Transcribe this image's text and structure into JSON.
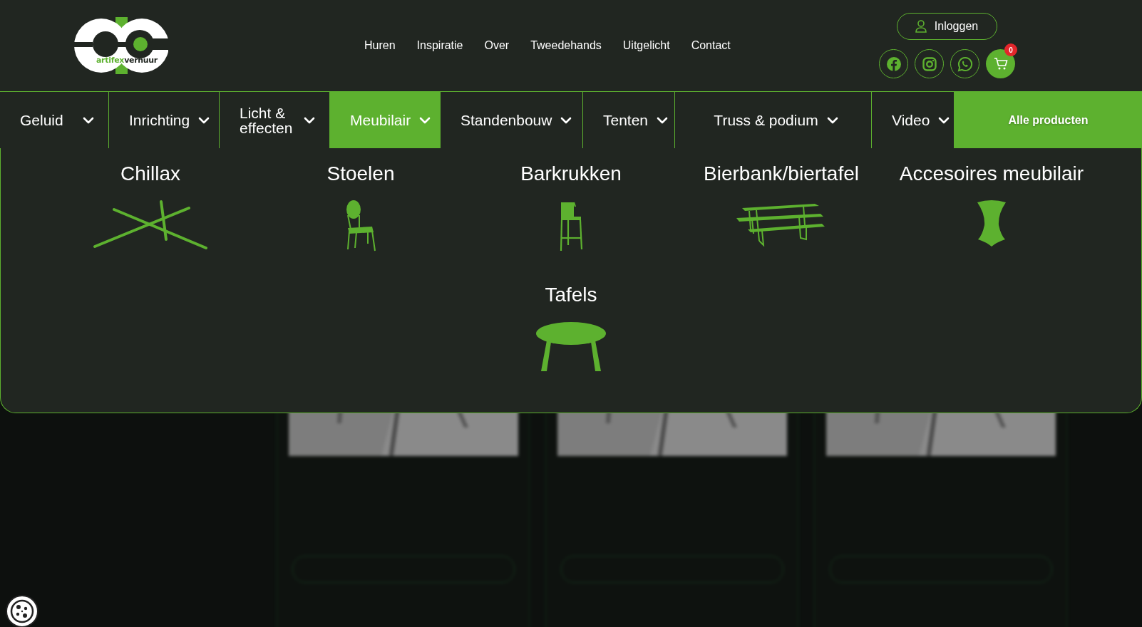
{
  "logo": {
    "text_green": "artifex",
    "text_dark": "verhuur"
  },
  "main_nav": [
    "Huren",
    "Inspiratie",
    "Over",
    "Tweedehands",
    "Uitgelicht",
    "Contact"
  ],
  "login_button": {
    "label": "Inloggen"
  },
  "social_links": [
    {
      "kind": "facebook"
    },
    {
      "kind": "instagram"
    },
    {
      "kind": "whatsapp"
    }
  ],
  "cart": {
    "count": "0"
  },
  "categories": [
    {
      "label": "Geluid",
      "selected": false
    },
    {
      "label": "Inrichting",
      "selected": false
    },
    {
      "label": "Licht & effecten",
      "selected": false
    },
    {
      "label": "Meubilair",
      "selected": true
    },
    {
      "label": "Standenbouw",
      "selected": false
    },
    {
      "label": "Tenten",
      "selected": false
    },
    {
      "label": "Truss & podium",
      "selected": false
    },
    {
      "label": "Video",
      "selected": false
    }
  ],
  "all_products": {
    "label": "Alle producten"
  },
  "submenu": [
    {
      "title": "Chillax",
      "kind": "lounger"
    },
    {
      "title": "Stoelen",
      "kind": "chair"
    },
    {
      "title": "Barkrukken",
      "kind": "stool"
    },
    {
      "title": "Bierbank/biertafel",
      "kind": "bench"
    },
    {
      "title": "Accesoires meubilair",
      "kind": "cover"
    },
    {
      "title": "Tafels",
      "kind": "table"
    }
  ]
}
